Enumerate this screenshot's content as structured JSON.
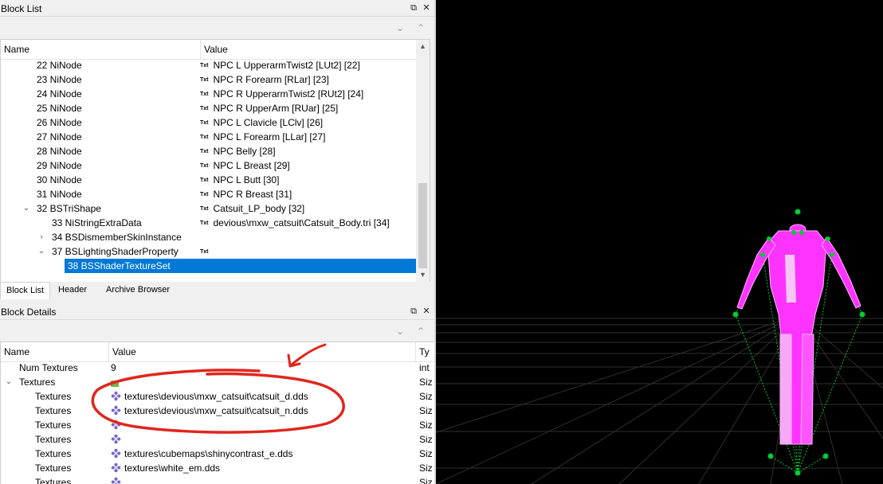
{
  "block_list": {
    "title": "Block List",
    "columns": {
      "name": "Name",
      "value": "Value"
    },
    "rows": [
      {
        "name": "22 NiNode",
        "value": "NPC L UpperarmTwist2 [LUt2] [22]",
        "txt": "Txt"
      },
      {
        "name": "23 NiNode",
        "value": "NPC R Forearm [RLar] [23]",
        "txt": "Txt"
      },
      {
        "name": "24 NiNode",
        "value": "NPC R UpperarmTwist2 [RUt2] [24]",
        "txt": "Txt"
      },
      {
        "name": "25 NiNode",
        "value": "NPC R UpperArm [RUar] [25]",
        "txt": "Txt"
      },
      {
        "name": "26 NiNode",
        "value": "NPC L Clavicle [LClv] [26]",
        "txt": "Txt"
      },
      {
        "name": "27 NiNode",
        "value": "NPC L Forearm [LLar] [27]",
        "txt": "Txt"
      },
      {
        "name": "28 NiNode",
        "value": "NPC Belly [28]",
        "txt": "Txt"
      },
      {
        "name": "29 NiNode",
        "value": "NPC L Breast [29]",
        "txt": "Txt"
      },
      {
        "name": "30 NiNode",
        "value": "NPC L Butt [30]",
        "txt": "Txt"
      },
      {
        "name": "31 NiNode",
        "value": "NPC R Breast [31]",
        "txt": "Txt"
      },
      {
        "name": "32 BSTriShape",
        "value": "Catsuit_LP_body [32]",
        "txt": "Txt"
      },
      {
        "name": "33 NiStringExtraData",
        "value": "devious\\mxw_catsuit\\Catsuit_Body.tri [34]",
        "txt": "Txt"
      },
      {
        "name": "34 BSDismemberSkinInstance",
        "value": "",
        "txt": ""
      },
      {
        "name": "37 BSLightingShaderProperty",
        "value": "",
        "txt": "Txt"
      },
      {
        "name": "38 BSShaderTextureSet",
        "value": "",
        "txt": ""
      }
    ],
    "selected": "38 BSShaderTextureSet"
  },
  "tabs": [
    "Block List",
    "Header",
    "Archive Browser"
  ],
  "block_details": {
    "title": "Block Details",
    "columns": {
      "name": "Name",
      "value": "Value",
      "type": "Ty"
    },
    "rows": [
      {
        "name": "Num Textures",
        "value": "9",
        "type": "int"
      },
      {
        "name": "Textures",
        "value": "",
        "type": "Siz"
      },
      {
        "name": "Textures",
        "value": "textures\\devious\\mxw_catsuit\\catsuit_d.dds",
        "type": "Siz"
      },
      {
        "name": "Textures",
        "value": "textures\\devious\\mxw_catsuit\\catsuit_n.dds",
        "type": "Siz"
      },
      {
        "name": "Textures",
        "value": "",
        "type": "Siz"
      },
      {
        "name": "Textures",
        "value": "",
        "type": "Siz"
      },
      {
        "name": "Textures",
        "value": "textures\\cubemaps\\shinycontrast_e.dds",
        "type": "Siz"
      },
      {
        "name": "Textures",
        "value": "textures\\white_em.dds",
        "type": "Siz"
      },
      {
        "name": "Textures",
        "value": "",
        "type": "Siz"
      }
    ]
  },
  "icons": {
    "float": "float-icon",
    "close": "close-icon",
    "expand_all": "double-chevron-down-icon",
    "collapse_all": "double-chevron-up-icon",
    "texture": "texture-flower-icon"
  },
  "colors": {
    "selection": "#0078d7",
    "mesh": "#ff33ff",
    "skeleton": "#00cc33",
    "annotation": "#e0261d",
    "grid": "#2f2f2f"
  }
}
